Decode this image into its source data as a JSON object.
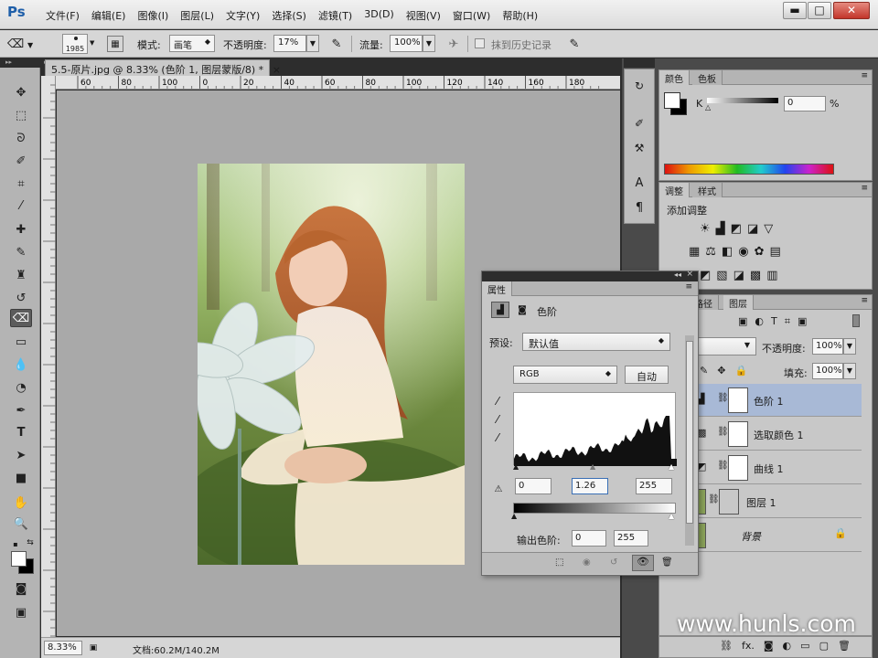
{
  "app": {
    "logo": "Ps"
  },
  "menu": [
    "文件(F)",
    "编辑(E)",
    "图像(I)",
    "图层(L)",
    "文字(Y)",
    "选择(S)",
    "滤镜(T)",
    "3D(D)",
    "视图(V)",
    "窗口(W)",
    "帮助(H)"
  ],
  "window_buttons": {
    "minimize": "▬",
    "maximize": "□",
    "close": "✕"
  },
  "options": {
    "brush_size": "1985",
    "mode_label": "模式:",
    "mode_value": "画笔",
    "opacity_label": "不透明度:",
    "opacity_value": "17%",
    "flow_label": "流量:",
    "flow_value": "100%",
    "history_label": "抹到历史记录"
  },
  "document": {
    "tab_title": "5.5-原片.jpg @ 8.33% (色阶 1, 图层蒙版/8) *",
    "tab_close": "×",
    "ruler_ticks": [
      "60",
      "80",
      "100",
      "0",
      "20",
      "40",
      "60",
      "80",
      "100",
      "120",
      "140",
      "160",
      "180"
    ],
    "zoom": "8.33%",
    "doc_info": "文档:60.2M/140.2M"
  },
  "color_panel": {
    "tabs": [
      "颜色",
      "色板"
    ],
    "channel_label": "K",
    "value": "0",
    "unit": "%"
  },
  "adjust_panel": {
    "tabs": [
      "调整",
      "样式"
    ],
    "heading": "添加调整"
  },
  "properties": {
    "tab": "属性",
    "title": "色阶",
    "preset_label": "预设:",
    "preset_value": "默认值",
    "channel_value": "RGB",
    "auto_label": "自动",
    "input_black": "0",
    "input_gray": "1.26",
    "input_white": "255",
    "output_label": "输出色阶:",
    "output_black": "0",
    "output_white": "255"
  },
  "layers_panel": {
    "tabs": [
      "路径",
      "图层"
    ],
    "opacity_label": "不透明度:",
    "opacity_value": "100%",
    "fill_label": "填充:",
    "fill_value": "100%",
    "layers": [
      {
        "name": "色阶 1",
        "selected": true
      },
      {
        "name": "选取颜色 1",
        "selected": false
      },
      {
        "name": "曲线 1",
        "selected": false
      },
      {
        "name": "图层 1",
        "selected": false
      },
      {
        "name": "背景",
        "selected": false
      }
    ],
    "bottom_fx": "fx."
  },
  "watermark": "www.hunls.com",
  "colors": {
    "accent": "#1f5fa9",
    "layer_selected": "#a8b9d6",
    "panel_bg": "#c8c8c8"
  }
}
